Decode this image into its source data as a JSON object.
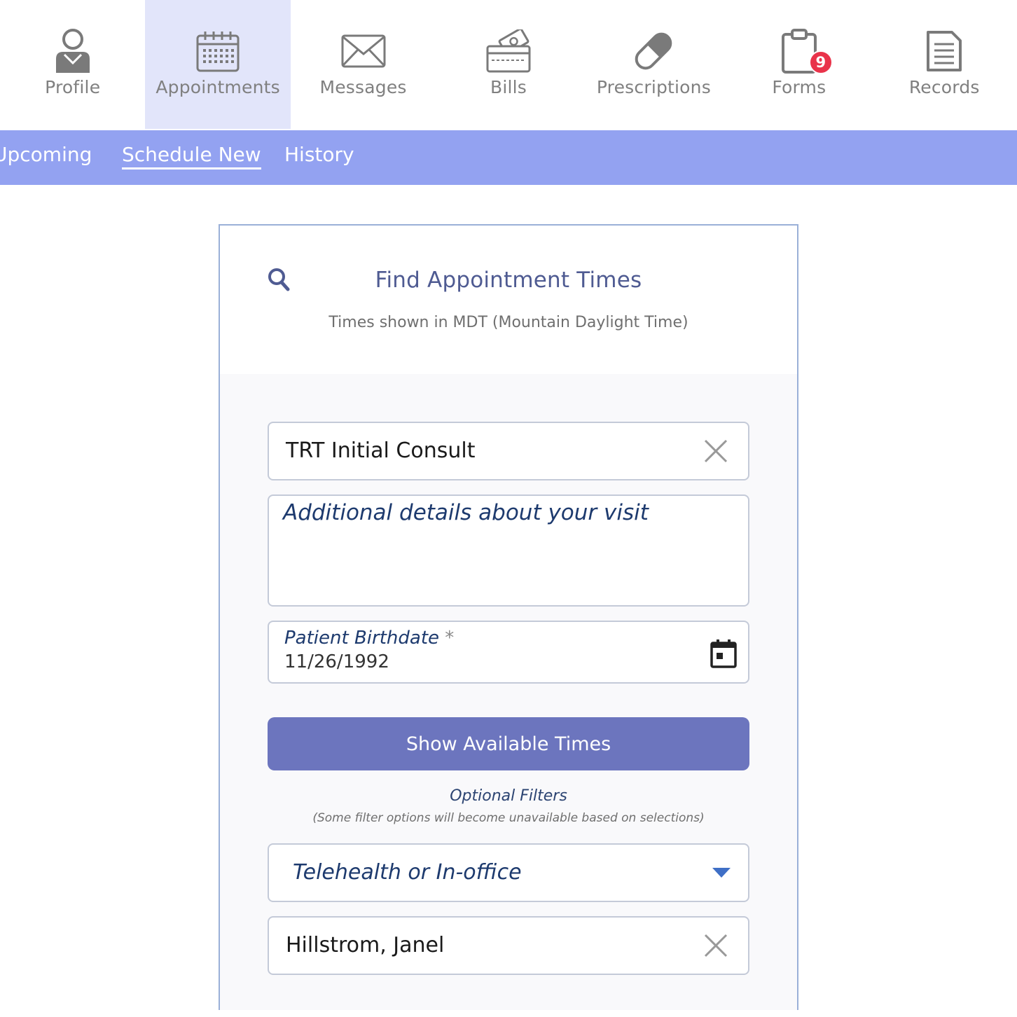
{
  "nav": {
    "items": [
      {
        "label": "Profile",
        "icon": "person-icon"
      },
      {
        "label": "Appointments",
        "icon": "calendar-icon"
      },
      {
        "label": "Messages",
        "icon": "envelope-icon"
      },
      {
        "label": "Bills",
        "icon": "wallet-icon"
      },
      {
        "label": "Prescriptions",
        "icon": "pill-icon"
      },
      {
        "label": "Forms",
        "icon": "clipboard-icon",
        "badge": "9"
      },
      {
        "label": "Records",
        "icon": "document-icon"
      }
    ],
    "active": "Appointments"
  },
  "subnav": {
    "tabs": [
      {
        "label": "Upcoming"
      },
      {
        "label": "Schedule New"
      },
      {
        "label": "History"
      }
    ],
    "selected": "Schedule New"
  },
  "card": {
    "title": "Find Appointment Times",
    "subtitle": "Times shown in MDT (Mountain Daylight Time)"
  },
  "form": {
    "visit_type": "TRT Initial Consult",
    "details_placeholder": "Additional details about your visit",
    "birthdate_label": "Patient Birthdate",
    "required_mark": "*",
    "birthdate_value": "11/26/1992",
    "submit_label": "Show Available Times",
    "optional_title": "Optional Filters",
    "optional_note": "(Some filter options will become unavailable based on selections)",
    "location_select": "Telehealth or In-office",
    "provider": "Hillstrom, Janel"
  },
  "colors": {
    "accent": "#6c75be",
    "subnav": "#93a2f1",
    "active_nav": "#e2e5fa",
    "badge": "#e9334a"
  }
}
